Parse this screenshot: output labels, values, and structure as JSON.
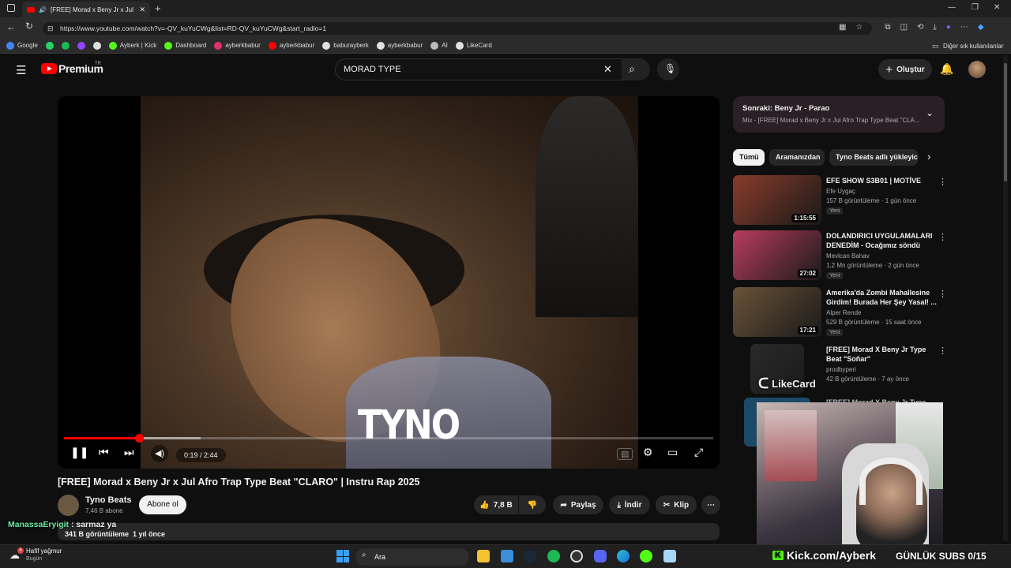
{
  "browser": {
    "tab_title": "[FREE] Morad x Beny Jr x Jul",
    "url": "https://www.youtube.com/watch?v=-QV_kuYuCWg&list=RD-QV_kuYuCWg&start_radio=1",
    "bookmarks": [
      {
        "label": "Google",
        "color": "#4285f4"
      },
      {
        "label": "",
        "color": "#25d366"
      },
      {
        "label": "",
        "color": "#1db954"
      },
      {
        "label": "",
        "color": "#9146ff"
      },
      {
        "label": "",
        "color": "#e0e0e0"
      },
      {
        "label": "Ayberk | Kick",
        "color": "#53fc18"
      },
      {
        "label": "Dashboard",
        "color": "#53fc18"
      },
      {
        "label": "ayberkbabur",
        "color": "#e1306c"
      },
      {
        "label": "ayberkbabur",
        "color": "#ff0000"
      },
      {
        "label": "baburayberk",
        "color": "#e0e0e0"
      },
      {
        "label": "ayberkbabur",
        "color": "#e0e0e0"
      },
      {
        "label": "AI",
        "color": "#bbbbbb"
      },
      {
        "label": "LikeCard",
        "color": "#e0e0e0"
      }
    ],
    "other_bookmarks": "Diğer sık kullanılanlar"
  },
  "header": {
    "logo_text": "Premium",
    "region": "TR",
    "search_value": "MORAD TYPE",
    "create_label": "Oluştur"
  },
  "player": {
    "watermark": "TYNO",
    "time": "0:19 / 2:44",
    "played_fraction": 0.116,
    "buffered_fraction": 0.21
  },
  "video": {
    "title": "[FREE] Morad x Beny Jr x Jul Afro Trap Type Beat \"CLARO\" | Instru Rap 2025",
    "channel": "Tyno Beats",
    "subs": "7,46 B abone",
    "subscribe": "Abone ol",
    "likes": "7,8 B",
    "share": "Paylaş",
    "download": "İndir",
    "clip": "Klip",
    "views": "341 B görüntüleme",
    "date": "1 yıl önce"
  },
  "chat_overlay": {
    "user": "ManassaEryigit",
    "message": " : sarmaz ya"
  },
  "next": {
    "title": "Sonraki: Beny Jr - Parao",
    "subtitle": "Mix - [FREE] Morad x Beny Jr x Jul Afro Trap Type Beat \"CLA..."
  },
  "chips": [
    "Tümü",
    "Aramanızdan",
    "Tyno Beats adlı yükleyic"
  ],
  "recommendations": [
    {
      "title": "EFE SHOW S3B01 | MOTİVE",
      "channel": "Efe Uygaç",
      "meta": "157 B görüntüleme · 1 gün önce",
      "duration": "1:15:55",
      "badge": "Yeni",
      "thumb": "#8a3b2a"
    },
    {
      "title": "DOLANDIRICI UYGULAMALARI DENEDİM - Ocağımız söndü",
      "channel": "Mevlcan Bahav",
      "meta": "1,2 Mn görüntüleme · 2 gün önce",
      "duration": "27:02",
      "badge": "Yeni",
      "thumb": "#b83c5e"
    },
    {
      "title": "Amerika'da Zombi Mahallesine Girdim! Burada Her Şey Yasal! ...",
      "channel": "Alper Rende",
      "meta": "529 B görüntüleme · 15 saat önce",
      "duration": "17:21",
      "badge": "Yeni",
      "thumb": "#6a5238"
    },
    {
      "title": "[FREE]  Morad X Beny Jr Type Beat \"Soñar\"",
      "channel": "prodbyperi",
      "meta": "42 B görüntüleme · 7 ay önce",
      "duration": "",
      "badge": "",
      "thumb": "#2a2a2a"
    }
  ],
  "partial_rec_title": "[FREE] Morad X Beny Jr Type",
  "likecard_overlay": "LikeCard",
  "stream_overlay": {
    "kick_url": "Kick.com/Ayberk",
    "subs_goal": "GÜNLÜK SUBS 0/15"
  },
  "taskbar": {
    "weather": "Hafif yağmur",
    "weather_sub": "Bugün",
    "search": "Ara",
    "temp": "4"
  }
}
